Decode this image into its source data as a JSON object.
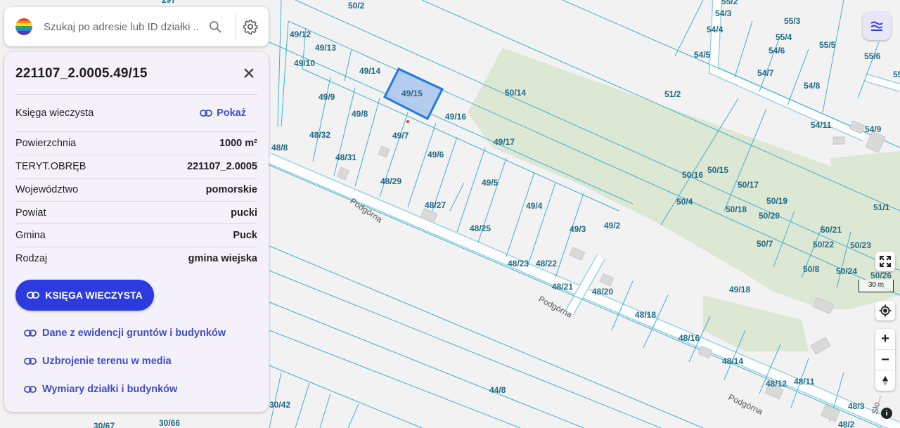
{
  "search": {
    "placeholder": "Szukaj po adresie lub ID działki ..."
  },
  "panel": {
    "title": "221107_2.0005.49/15",
    "rows": [
      {
        "label": "Księga wieczysta",
        "value": "Pokaż"
      },
      {
        "label": "Powierzchnia",
        "value": "1000 m²"
      },
      {
        "label": "TERYT.OBRĘB",
        "value": "221107_2.0005"
      },
      {
        "label": "Województwo",
        "value": "pomorskie"
      },
      {
        "label": "Powiat",
        "value": "pucki"
      },
      {
        "label": "Gmina",
        "value": "Puck"
      },
      {
        "label": "Rodzaj",
        "value": "gmina wiejska"
      }
    ],
    "button_label": "KSIĘGA WIECZYSTA",
    "links": [
      "Dane z ewidencji gruntów i budynków",
      "Uzbrojenie terenu w media",
      "Wymiary działki i budynków"
    ]
  },
  "map": {
    "scale_label": "30 m",
    "streets": [
      "Podgórna",
      "Podgórna",
      "Podgórna",
      "Sło..."
    ],
    "parcels": [
      "297",
      "50/2",
      "55/2",
      "54/3",
      "54/4",
      "55/3",
      "55/4",
      "54/6",
      "55/5",
      "55/6",
      "54/5",
      "54/7",
      "54/8",
      "55/",
      "49/12",
      "49/13",
      "49/10",
      "49/14",
      "49/15",
      "50/14",
      "51/2",
      "49/9",
      "49/8",
      "49/16",
      "54/11",
      "54/9",
      "48/32",
      "49/7",
      "48/8",
      "49/17",
      "48/31",
      "49/6",
      "50/16",
      "50/15",
      "48/29",
      "49/5",
      "50/17",
      "50/4",
      "50/19",
      "50/18",
      "51/1",
      "48/27",
      "49/4",
      "50/20",
      "48/25",
      "49/3",
      "49/2",
      "50/21",
      "50/7",
      "50/22",
      "50/23",
      "48/23",
      "48/22",
      "50/8",
      "50/24",
      "50/26",
      "48/21",
      "48/20",
      "49/18",
      "48/18",
      "48/16",
      "48/14",
      "48/12",
      "48/11",
      "44/8",
      "30/42",
      "30/66",
      "30/67",
      "48/3",
      "48/2"
    ],
    "selected_parcel": "49/15"
  },
  "colors": {
    "accent": "#2b3be0",
    "link": "#3f4ec8",
    "parcel_line": "#3fb0d0",
    "parcel_label": "#1f6b85",
    "selected_fill": "#a9c6ec",
    "selected_stroke": "#1e7be0",
    "green_area": "#dde8d4"
  },
  "icons": {
    "search": "search-icon",
    "settings": "gear-icon",
    "close": "close-icon",
    "link": "link-icon",
    "layers": "layers-icon",
    "fullscreen": "fullscreen-icon",
    "locate": "locate-icon",
    "zoom_in": "plus-icon",
    "zoom_out": "minus-icon",
    "compass": "compass-icon",
    "info": "info-icon"
  }
}
